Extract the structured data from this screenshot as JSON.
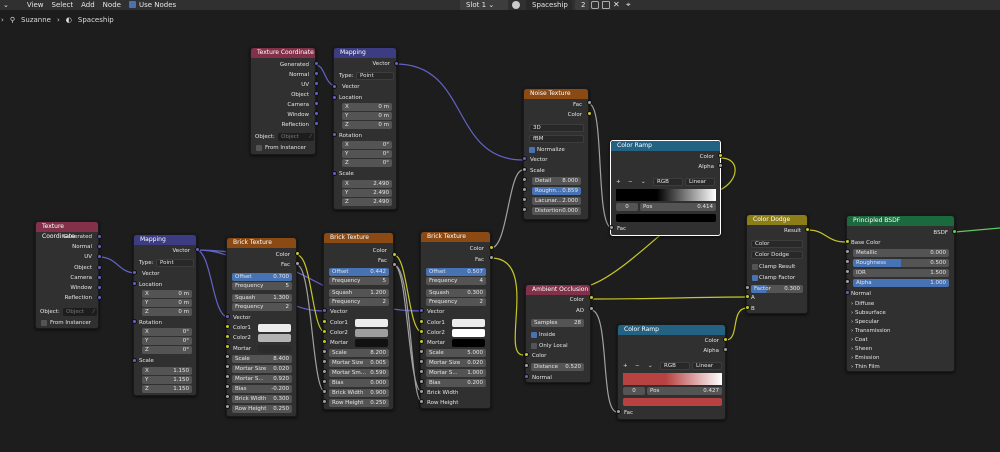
{
  "topbar": {
    "menu": [
      "View",
      "Select",
      "Add",
      "Node"
    ],
    "use_nodes": "Use Nodes",
    "slot": "Slot 1",
    "material": "Spaceship",
    "users": "2"
  },
  "breadcrumb": {
    "object": "Suzanne",
    "material": "Spaceship"
  },
  "nodes": {
    "tc1": {
      "title": "Texture Coordinate",
      "outputs": [
        "Generated",
        "Normal",
        "UV",
        "Object",
        "Camera",
        "Window",
        "Reflection"
      ],
      "object_label": "Object:",
      "object_placeholder": "Object",
      "from_instancer": "From Instancer"
    },
    "map1": {
      "title": "Mapping",
      "out_vector": "Vector",
      "type_label": "Type:",
      "type_value": "Point",
      "in_vector": "Vector",
      "location": "Location",
      "loc": [
        [
          "X",
          "0 m"
        ],
        [
          "Y",
          "0 m"
        ],
        [
          "Z",
          "0 m"
        ]
      ],
      "rotation": "Rotation",
      "rot": [
        [
          "X",
          "0°"
        ],
        [
          "Y",
          "0°"
        ],
        [
          "Z",
          "0°"
        ]
      ],
      "scale": "Scale",
      "scl": [
        [
          "X",
          "2.490"
        ],
        [
          "Y",
          "2.490"
        ],
        [
          "Z",
          "2.490"
        ]
      ]
    },
    "tc2": {
      "title": "Texture Coordinate",
      "outputs": [
        "Generated",
        "Normal",
        "UV",
        "Object",
        "Camera",
        "Window",
        "Reflection"
      ],
      "object_label": "Object:",
      "object_placeholder": "Object",
      "from_instancer": "From Instancer"
    },
    "map2": {
      "title": "Mapping",
      "out_vector": "Vector",
      "type_label": "Type:",
      "type_value": "Point",
      "in_vector": "Vector",
      "location": "Location",
      "loc": [
        [
          "X",
          "0 m"
        ],
        [
          "Y",
          "0 m"
        ],
        [
          "Z",
          "0 m"
        ]
      ],
      "rotation": "Rotation",
      "rot": [
        [
          "X",
          "0°"
        ],
        [
          "Y",
          "0°"
        ],
        [
          "Z",
          "0°"
        ]
      ],
      "scale": "Scale",
      "scl": [
        [
          "X",
          "1.150"
        ],
        [
          "Y",
          "1.150"
        ],
        [
          "Z",
          "1.150"
        ]
      ]
    },
    "brick1": {
      "title": "Brick Texture",
      "out_color": "Color",
      "out_fac": "Fac",
      "offset": [
        "Offset",
        "0.700"
      ],
      "frequency": [
        "Frequency",
        "5"
      ],
      "squash": [
        "Squash",
        "1.300"
      ],
      "frequency2": [
        "Frequency",
        "2"
      ],
      "in_vector": "Vector",
      "color1": "Color1",
      "color2": "Color2",
      "mortar": "Mortar",
      "fields": [
        [
          "Scale",
          "8.400"
        ],
        [
          "Mortar Size",
          "0.020"
        ],
        [
          "Mortar S...",
          "0.920"
        ],
        [
          "Bias",
          "-0.200"
        ],
        [
          "Brick Width",
          "0.300"
        ],
        [
          "Row Height",
          "0.250"
        ]
      ]
    },
    "brick2": {
      "title": "Brick Texture",
      "out_color": "Color",
      "out_fac": "Fac",
      "offset": [
        "Offset",
        "0.442"
      ],
      "frequency": [
        "Frequency",
        "5"
      ],
      "squash": [
        "Squash",
        "1.200"
      ],
      "frequency2": [
        "Frequency",
        "2"
      ],
      "in_vector": "Vector",
      "color1": "Color1",
      "color2": "Color2",
      "mortar": "Mortar",
      "fields": [
        [
          "Scale",
          "8.200"
        ],
        [
          "Mortar Size",
          "0.005"
        ],
        [
          "Mortar Sm...",
          "0.590"
        ],
        [
          "Bias",
          "0.000"
        ]
      ],
      "brick_width": "Brick Width",
      "brick_width_val": "0.900",
      "row_height": "Row Height",
      "row_height_val": "0.250"
    },
    "brick3": {
      "title": "Brick Texture",
      "out_color": "Color",
      "out_fac": "Fac",
      "offset": [
        "Offset",
        "0.507"
      ],
      "frequency": [
        "Frequency",
        "4"
      ],
      "squash": [
        "Squash",
        "0.300"
      ],
      "frequency2": [
        "Frequency",
        "2"
      ],
      "in_vector": "Vector",
      "color1": "Color1",
      "color2": "Color2",
      "mortar": "Mortar",
      "fields": [
        [
          "Scale",
          "5.000"
        ],
        [
          "Mortar Size",
          "0.020"
        ],
        [
          "Mortar S...",
          "1.000"
        ],
        [
          "Bias",
          "0.200"
        ]
      ],
      "brick_width": "Brick Width",
      "row_height": "Row Height"
    },
    "noise": {
      "title": "Noise Texture",
      "out_fac": "Fac",
      "out_color": "Color",
      "dim": "3D",
      "type": "fBM",
      "normalize": "Normalize",
      "in_vector": "Vector",
      "in_scale": "Scale",
      "fields": [
        [
          "Detail",
          "8.000"
        ],
        [
          "Roughn...",
          "0.859"
        ],
        [
          "Lacunar...",
          "2.000"
        ],
        [
          "Distortion",
          "0.000"
        ]
      ]
    },
    "ramp1": {
      "title": "Color Ramp",
      "out_color": "Color",
      "out_alpha": "Alpha",
      "mode": "RGB",
      "interp": "Linear",
      "index": "0",
      "pos_label": "Pos",
      "pos": "0.414",
      "fac": "Fac",
      "plus": "+",
      "minus": "−"
    },
    "ao": {
      "title": "Ambient Occlusion",
      "out_color": "Color",
      "out_ao": "AO",
      "samples": [
        "Samples",
        "28"
      ],
      "inside": "Inside",
      "only_local": "Only Local",
      "in_color": "Color",
      "distance": [
        "Distance",
        "0.520"
      ],
      "normal": "Normal"
    },
    "ramp2": {
      "title": "Color Ramp",
      "out_color": "Color",
      "out_alpha": "Alpha",
      "mode": "RGB",
      "interp": "Linear",
      "index": "0",
      "pos_label": "Pos",
      "pos": "0.427",
      "fac": "Fac",
      "plus": "+",
      "minus": "−"
    },
    "dodge": {
      "title": "Color Dodge",
      "out_result": "Result",
      "sel1": "Color",
      "sel2": "Color Dodge",
      "clamp_result": "Clamp Result",
      "clamp_factor": "Clamp Factor",
      "factor": [
        "Factor",
        "0.300"
      ],
      "a": "A",
      "b": "B"
    },
    "bsdf": {
      "title": "Principled BSDF",
      "out_bsdf": "BSDF",
      "base_color": "Base Color",
      "fields": [
        [
          "Metallic",
          "0.000"
        ],
        [
          "Roughness",
          "0.500"
        ],
        [
          "IOR",
          "1.500"
        ],
        [
          "Alpha",
          "1.000"
        ]
      ],
      "normal": "Normal",
      "panels": [
        "Diffuse",
        "Subsurface",
        "Specular",
        "Transmission",
        "Coat",
        "Sheen",
        "Emission",
        "Thin Film"
      ]
    }
  },
  "colors": {
    "input": "#83314a",
    "vector": "#3c3c83",
    "texture": "#8b4a14",
    "converter": "#246283",
    "color": "#8c7d16",
    "shader": "#1b6a3e",
    "field_blue": "#4772b3"
  }
}
